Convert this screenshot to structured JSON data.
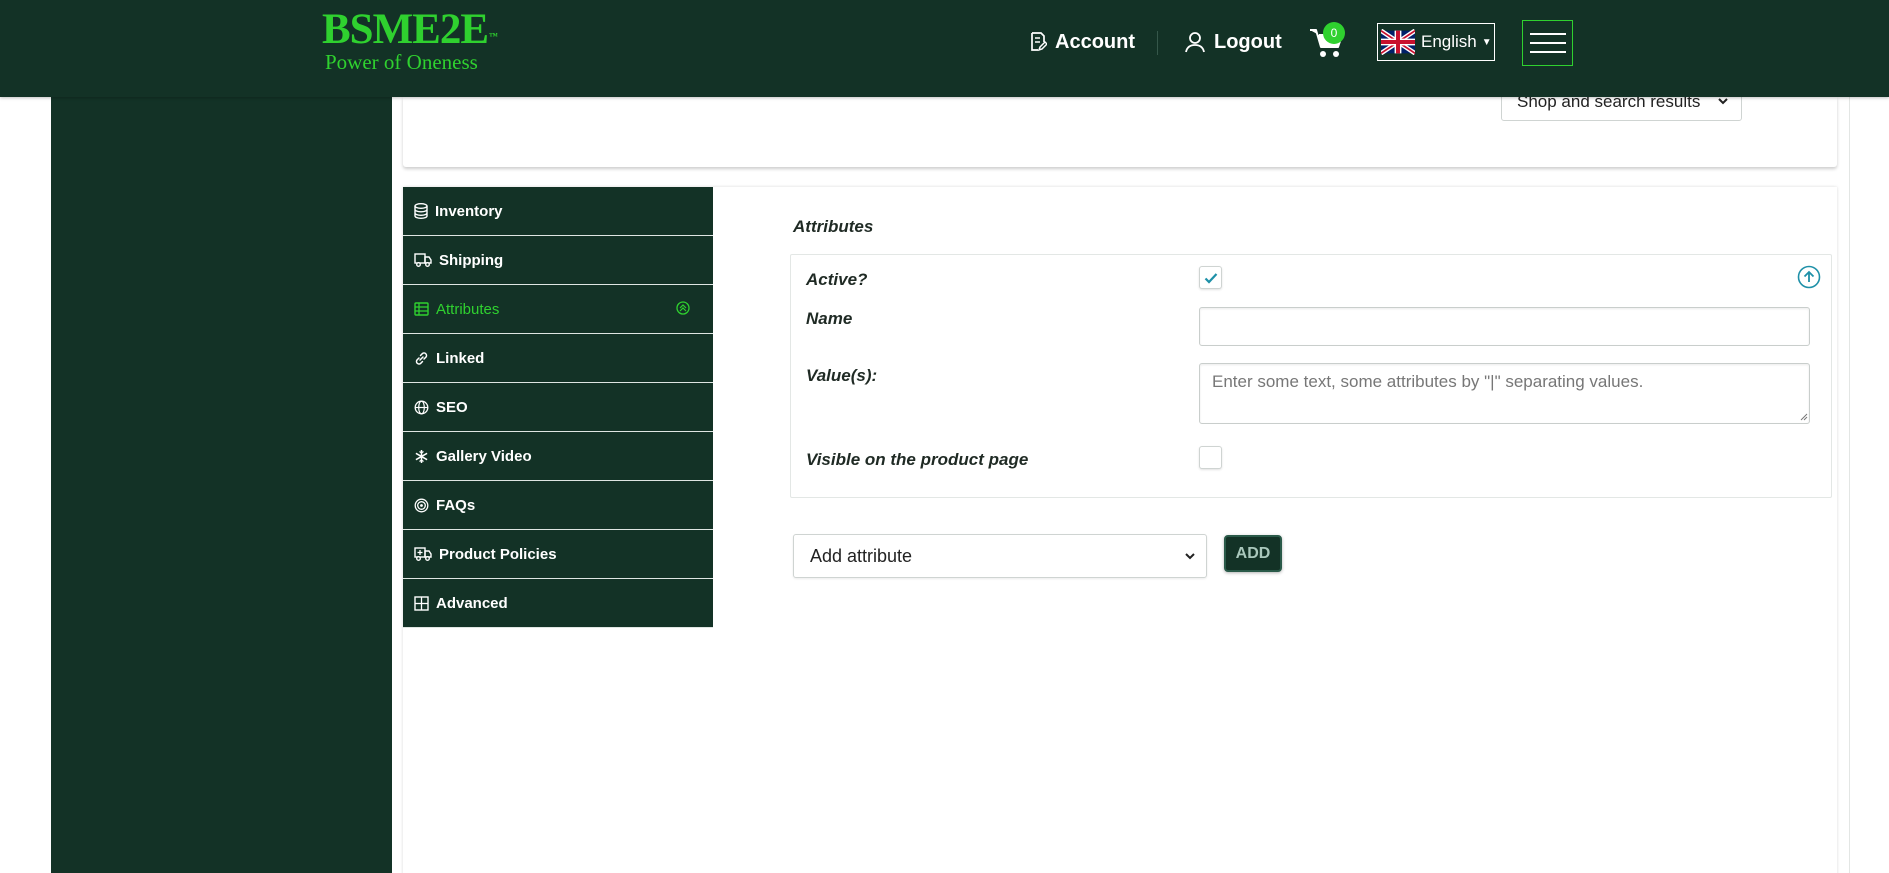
{
  "header": {
    "logo_brand": "BSME2E",
    "logo_trademark": "™",
    "logo_tagline": "Power of Oneness",
    "account_label": "Account",
    "logout_label": "Logout",
    "cart_count": "0",
    "language_label": "English"
  },
  "top_filter": {
    "selected": "Shop and search results"
  },
  "tabs": [
    {
      "label": "Inventory",
      "icon": "database-icon"
    },
    {
      "label": "Shipping",
      "icon": "truck-icon"
    },
    {
      "label": "Attributes",
      "icon": "table-list-icon",
      "active": true
    },
    {
      "label": "Linked",
      "icon": "link-icon"
    },
    {
      "label": "SEO",
      "icon": "globe-icon"
    },
    {
      "label": "Gallery Video",
      "icon": "snowflake-icon"
    },
    {
      "label": "FAQs",
      "icon": "target-icon"
    },
    {
      "label": "Product Policies",
      "icon": "truck-medical-icon"
    },
    {
      "label": "Advanced",
      "icon": "grid-icon"
    }
  ],
  "attributes_panel": {
    "title": "Attributes",
    "active_label": "Active?",
    "active_checked": true,
    "name_label": "Name",
    "name_value": "",
    "values_label": "Value(s):",
    "values_placeholder": "Enter some text, some attributes by \"|\" separating values.",
    "visible_label": "Visible on the product page",
    "visible_checked": false
  },
  "add_attribute": {
    "selected": "Add attribute",
    "button_label": "ADD"
  },
  "colors": {
    "header_bg": "#133226",
    "accent_green": "#2fd12f",
    "check_teal": "#1e90a8"
  }
}
